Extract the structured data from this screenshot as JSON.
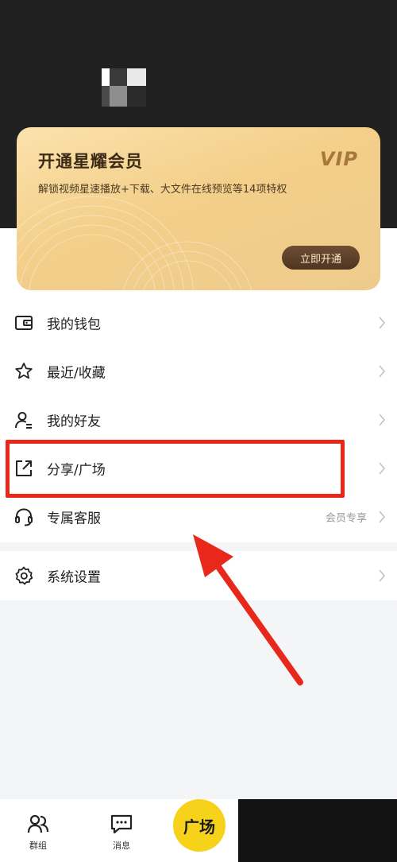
{
  "vip_card": {
    "title": "开通星耀会员",
    "subtitle": "解锁视频星速播放+下载、大文件在线预览等14项特权",
    "logo": "VIP",
    "button": "立即开通"
  },
  "menu": {
    "wallet": "我的钱包",
    "favorites": "最近/收藏",
    "friends": "我的好友",
    "share": "分享/广场",
    "service": "专属客服",
    "service_badge": "会员专享",
    "settings": "系统设置"
  },
  "tabs": {
    "group": "群组",
    "message": "消息",
    "plaza": "广场"
  },
  "colors": {
    "highlight": "#e8281a",
    "fab": "#f7d21a",
    "vip_gold": "#f3cf8a"
  }
}
